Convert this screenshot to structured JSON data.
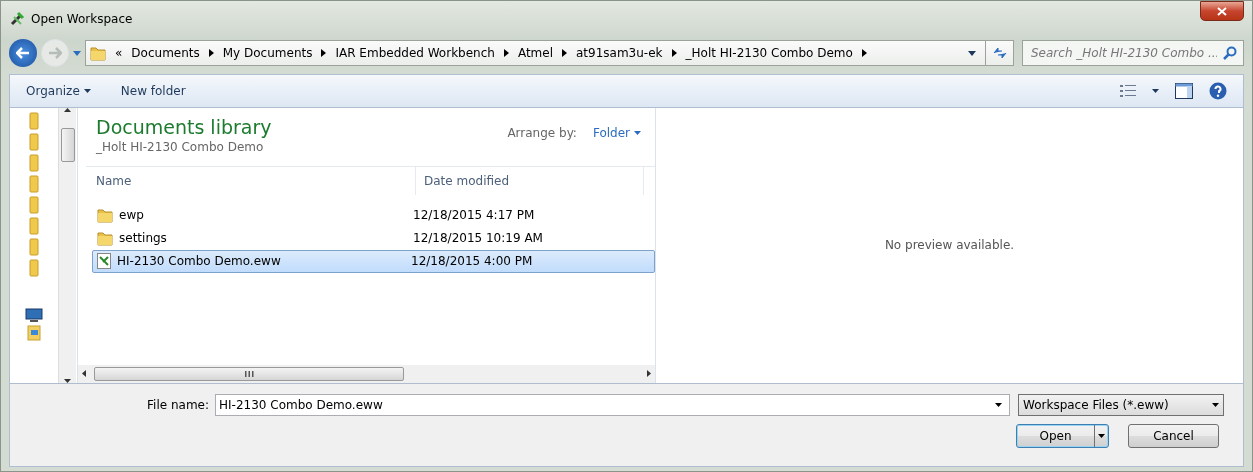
{
  "window": {
    "title": "Open Workspace"
  },
  "address": {
    "overflow": "«",
    "crumbs": [
      "Documents",
      "My Documents",
      "IAR Embedded Workbench",
      "Atmel",
      "at91sam3u-ek",
      "_Holt HI-2130 Combo Demo"
    ]
  },
  "search": {
    "placeholder": "Search _Holt HI-2130 Combo ..."
  },
  "toolbar": {
    "organize": "Organize",
    "new_folder": "New folder"
  },
  "nav_pane": {
    "items": [
      {
        "kind": "folder"
      },
      {
        "kind": "folder"
      },
      {
        "kind": "folder"
      },
      {
        "kind": "folder"
      },
      {
        "kind": "folder"
      },
      {
        "kind": "folder"
      },
      {
        "kind": "folder"
      },
      {
        "kind": "folder"
      },
      {
        "kind": "computer"
      },
      {
        "kind": "network"
      }
    ]
  },
  "library": {
    "title": "Documents library",
    "subtitle": "_Holt HI-2130 Combo Demo",
    "arrange_label": "Arrange by:",
    "arrange_value": "Folder"
  },
  "table": {
    "columns": [
      "Name",
      "Date modified"
    ],
    "rows": [
      {
        "kind": "folder",
        "name": "ewp",
        "date": "12/18/2015 4:17 PM",
        "selected": false
      },
      {
        "kind": "folder",
        "name": "settings",
        "date": "12/18/2015 10:19 AM",
        "selected": false
      },
      {
        "kind": "file",
        "name": "HI-2130 Combo Demo.eww",
        "date": "12/18/2015 4:00 PM",
        "selected": true
      }
    ]
  },
  "preview": {
    "message": "No preview available."
  },
  "bottom": {
    "file_name_label": "File name:",
    "file_name": "HI-2130 Combo Demo.eww",
    "filter": "Workspace Files (*.eww)",
    "open": "Open",
    "cancel": "Cancel"
  }
}
